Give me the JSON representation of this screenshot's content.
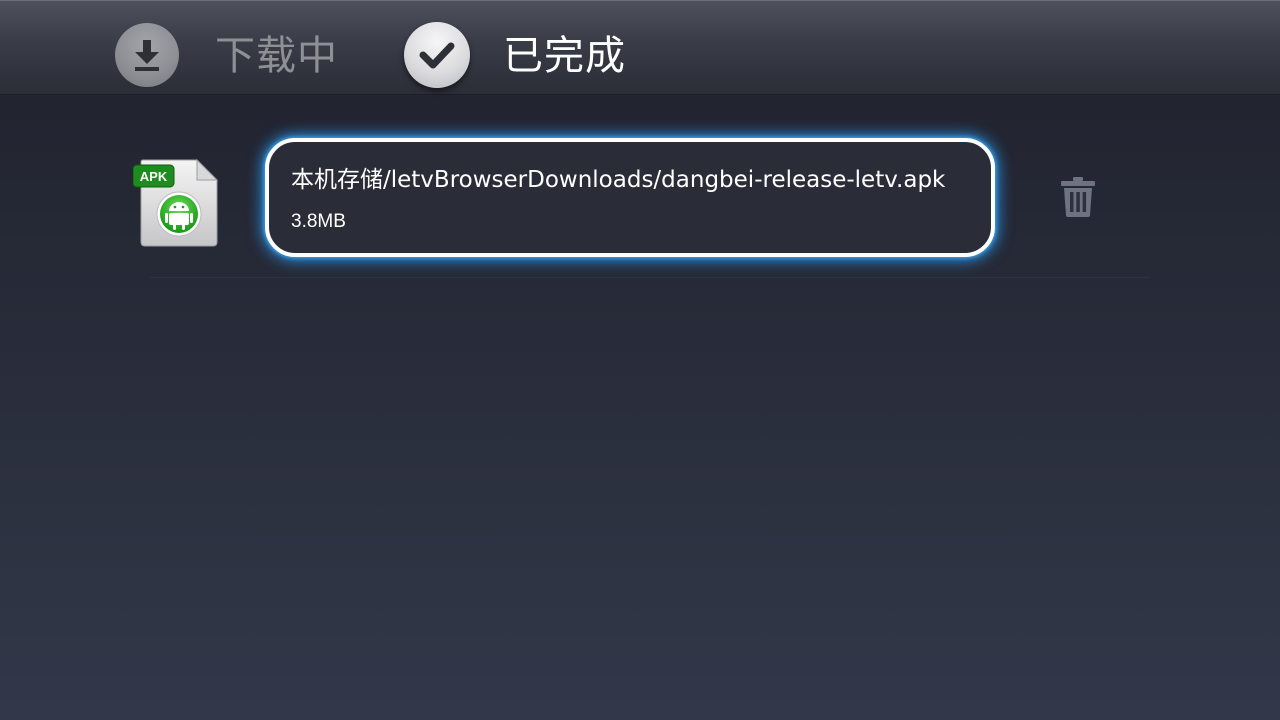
{
  "tabs": {
    "downloading": {
      "label": "下载中",
      "icon": "download-icon",
      "selected": false
    },
    "completed": {
      "label": "已完成",
      "icon": "check-icon",
      "selected": true
    }
  },
  "downloads": [
    {
      "badge": "APK",
      "path": "本机存储/letvBrowserDownloads/dangbei-release-letv.apk",
      "size": "3.8MB",
      "icon": "apk-android-icon",
      "delete_icon": "trash-icon"
    }
  ],
  "colors": {
    "focus_glow": "#28a0ff",
    "badge_green": "#2a9a2a",
    "android_green": "#3fbf2f"
  }
}
